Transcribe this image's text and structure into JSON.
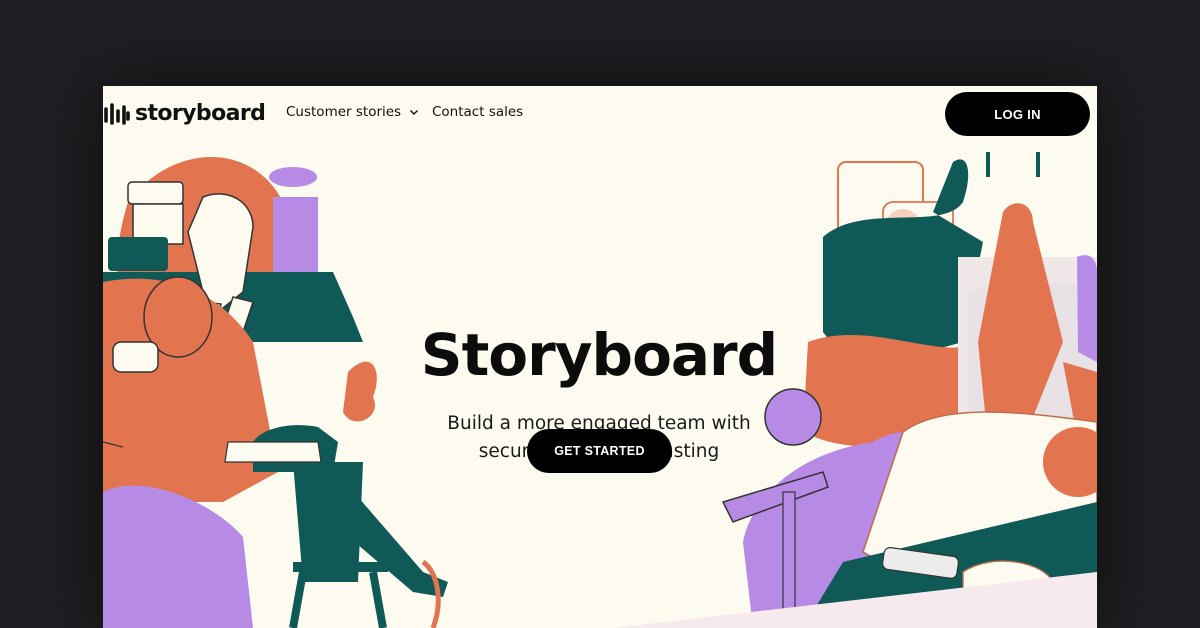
{
  "brand": {
    "name": "storyboard",
    "logo_icon": "wave-logo-icon"
  },
  "nav": {
    "links": [
      {
        "label": "Customer stories",
        "icon": "chevron-down-icon"
      },
      {
        "label": "Contact sales"
      }
    ],
    "login_label": "LOG IN"
  },
  "hero": {
    "title": "Storyboard",
    "subtitle_line1": "Build a more engaged team with",
    "subtitle_line2": "secure private podcasting",
    "cta_label": "GET STARTED"
  },
  "colors": {
    "page_background": "#1f1f23",
    "frame_background": "#fdfbef",
    "orange": "#e27550",
    "teal": "#0f5a56",
    "purple": "#b78ae6",
    "button": "#000000"
  }
}
